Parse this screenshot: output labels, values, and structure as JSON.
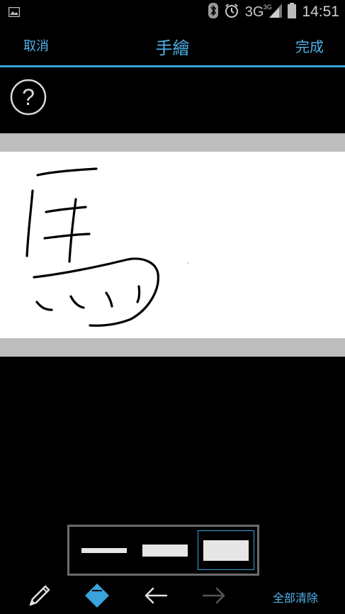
{
  "status_bar": {
    "network_label": "3G",
    "network_sub": "3G",
    "time": "14:51",
    "icons": [
      "image-notification-icon",
      "bluetooth-icon",
      "alarm-icon",
      "signal-icon",
      "battery-icon"
    ]
  },
  "action_bar": {
    "cancel_label": "取消",
    "title": "手繪",
    "done_label": "完成"
  },
  "help": {
    "icon": "help-icon",
    "glyph": "?"
  },
  "brush_sizes": {
    "options": [
      "thin",
      "medium",
      "thick"
    ],
    "selected_index": 2
  },
  "toolbar": {
    "pencil_icon": "pencil-icon",
    "eraser_icon": "eraser-icon",
    "undo_icon": "undo-arrow-icon",
    "redo_icon": "redo-arrow-icon",
    "redo_enabled": false,
    "clear_all_label": "全部清除"
  },
  "colors": {
    "accent": "#3aa2dc",
    "accent_text": "#4fb2ea",
    "background": "#000000",
    "canvas": "#ffffff",
    "canvas_border": "#bdbdbd"
  }
}
